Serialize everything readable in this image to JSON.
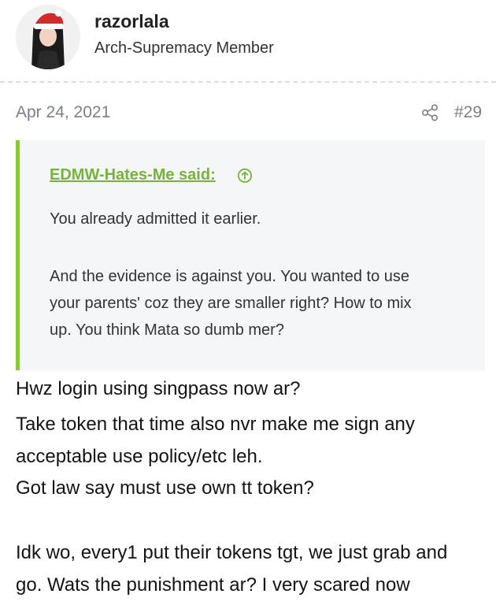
{
  "user": {
    "name": "razorlala",
    "title": "Arch-Supremacy Member"
  },
  "post": {
    "date": "Apr 24, 2021",
    "number": "#29"
  },
  "quote": {
    "author": "EDMW-Hates-Me said:",
    "lines": [
      "You already admitted it earlier.",
      "And the evidence is against you. You wanted to use",
      "your parents' coz they are smaller right? How to mix",
      "up. You think Mata so dumb mer?"
    ]
  },
  "body": {
    "lines": [
      "Hwz login using singpass now ar?",
      "Take token that time also nvr make me sign any",
      "acceptable use policy/etc leh.",
      "Got law say must use own tt token?",
      "Idk wo, every1 put their tokens tgt, we just grab and",
      "go. Wats the punishment ar? I very scared now"
    ]
  },
  "colors": {
    "quote_accent": "#8cc63f",
    "quote_author": "#77b33a",
    "meta_text": "#7a7f88"
  }
}
